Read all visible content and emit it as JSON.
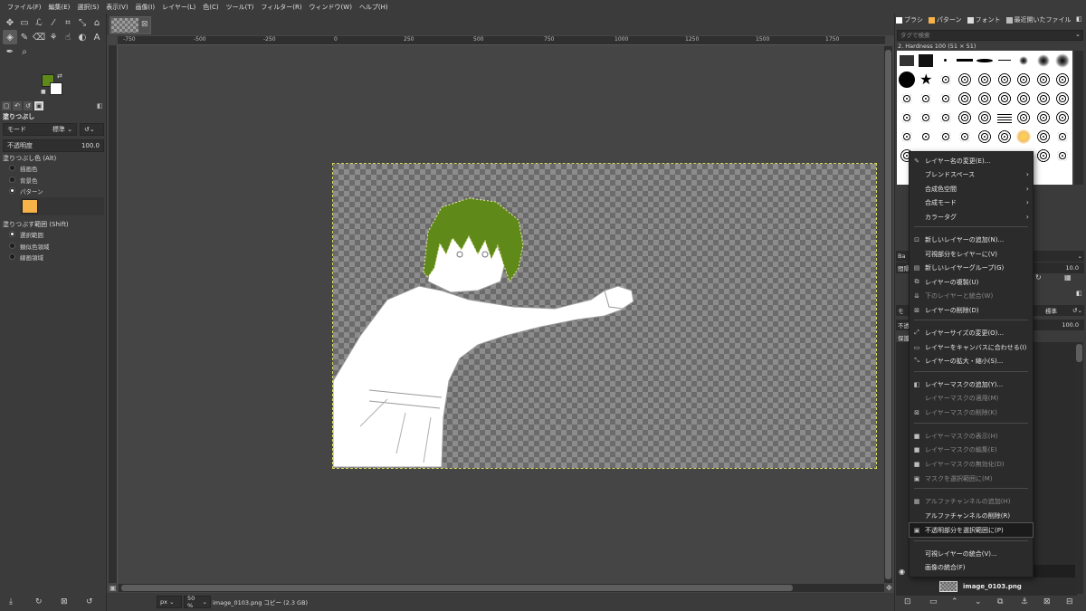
{
  "menubar": {
    "items": [
      "ファイル(F)",
      "編集(E)",
      "選択(S)",
      "表示(V)",
      "画像(I)",
      "レイヤー(L)",
      "色(C)",
      "ツール(T)",
      "フィルター(R)",
      "ウィンドウ(W)",
      "ヘルプ(H)"
    ]
  },
  "tool_options": {
    "title": "塗りつぶし",
    "mode_label": "モード",
    "mode_value": "標準",
    "opacity_label": "不透明度",
    "opacity_value": "100.0",
    "fill_type_title": "塗りつぶし色 (Alt)",
    "fill_options": [
      "描画色",
      "背景色",
      "パターン"
    ],
    "fill_selected": 2,
    "area_title": "塗りつぶす範囲 (Shift)",
    "area_options": [
      "選択範囲",
      "類似色領域",
      "線画領域"
    ],
    "area_selected": 0
  },
  "ruler": {
    "h_labels": [
      "-750",
      "-500",
      "-250",
      "0",
      "250",
      "500",
      "750",
      "1000",
      "1250",
      "1500",
      "1750"
    ]
  },
  "status": {
    "unit": "px",
    "zoom": "50 %",
    "info": "image_0103.png コピー (2.3 GB)"
  },
  "dock": {
    "tabs": [
      "ブラシ",
      "パターン",
      "フォント",
      "最近開いたファイル"
    ],
    "tag_placeholder": "タグで検索",
    "brush_name": "2. Hardness 100 (51 × 51)",
    "spacing_value": "10.0",
    "layer_mode_value": "標準",
    "layer_opacity_label": "不透明",
    "layer_opacity_value": "100.0",
    "layer_name": "image_0103.png",
    "partial_labels": [
      "Ba",
      "間隔",
      "モ",
      "保護"
    ]
  },
  "context_menu": {
    "items": [
      {
        "label": "レイヤー名の変更(E)...",
        "icon": "edit-icon",
        "enabled": true,
        "submenu": false
      },
      {
        "label": "ブレンドスペース",
        "icon": "",
        "enabled": true,
        "submenu": true
      },
      {
        "label": "合成色空間",
        "icon": "",
        "enabled": true,
        "submenu": true
      },
      {
        "label": "合成モード",
        "icon": "",
        "enabled": true,
        "submenu": true
      },
      {
        "label": "カラータグ",
        "icon": "",
        "enabled": true,
        "submenu": true
      },
      {
        "label": "新しいレイヤーの追加(N)...",
        "icon": "new-layer-icon",
        "enabled": true,
        "submenu": false
      },
      {
        "label": "可視部分をレイヤーに(V)",
        "icon": "",
        "enabled": true,
        "submenu": false
      },
      {
        "label": "新しいレイヤーグループ(G)",
        "icon": "folder-icon",
        "enabled": true,
        "submenu": false
      },
      {
        "label": "レイヤーの複製(U)",
        "icon": "duplicate-icon",
        "enabled": true,
        "submenu": false
      },
      {
        "label": "下のレイヤーと統合(W)",
        "icon": "merge-down-icon",
        "enabled": false,
        "submenu": false
      },
      {
        "label": "レイヤーの削除(D)",
        "icon": "delete-icon",
        "enabled": true,
        "submenu": false
      },
      {
        "label": "レイヤーサイズの変更(O)...",
        "icon": "resize-icon",
        "enabled": true,
        "submenu": false
      },
      {
        "label": "レイヤーをキャンバスに合わせる(I)",
        "icon": "fit-canvas-icon",
        "enabled": true,
        "submenu": false
      },
      {
        "label": "レイヤーの拡大・縮小(S)...",
        "icon": "scale-icon",
        "enabled": true,
        "submenu": false
      },
      {
        "label": "レイヤーマスクの追加(Y)...",
        "icon": "mask-add-icon",
        "enabled": true,
        "submenu": false
      },
      {
        "label": "レイヤーマスクの適用(M)",
        "icon": "",
        "enabled": false,
        "submenu": false
      },
      {
        "label": "レイヤーマスクの削除(K)",
        "icon": "mask-delete-icon",
        "enabled": false,
        "submenu": false
      },
      {
        "label": "レイヤーマスクの表示(H)",
        "icon": "checkbox-icon",
        "enabled": false,
        "submenu": false
      },
      {
        "label": "レイヤーマスクの編集(E)",
        "icon": "checkbox-icon",
        "enabled": false,
        "submenu": false
      },
      {
        "label": "レイヤーマスクの無効化(D)",
        "icon": "checkbox-icon",
        "enabled": false,
        "submenu": false
      },
      {
        "label": "マスクを選択範囲に(M)",
        "icon": "mask-selection-icon",
        "enabled": false,
        "submenu": false
      },
      {
        "label": "アルファチャンネルの追加(H)",
        "icon": "alpha-add-icon",
        "enabled": false,
        "submenu": false
      },
      {
        "label": "アルファチャンネルの削除(R)",
        "icon": "",
        "enabled": true,
        "submenu": false
      },
      {
        "label": "不透明部分を選択範囲に(P)",
        "icon": "alpha-selection-icon",
        "enabled": true,
        "submenu": false,
        "highlighted": true
      },
      {
        "label": "可視レイヤーの統合(V)...",
        "icon": "",
        "enabled": true,
        "submenu": false
      },
      {
        "label": "画像の統合(F)",
        "icon": "",
        "enabled": true,
        "submenu": false
      }
    ]
  },
  "colors": {
    "foreground": "#5f8a1a",
    "background": "#ffffff",
    "pattern": "#f7b34a",
    "hair": "#5f8a1a"
  }
}
